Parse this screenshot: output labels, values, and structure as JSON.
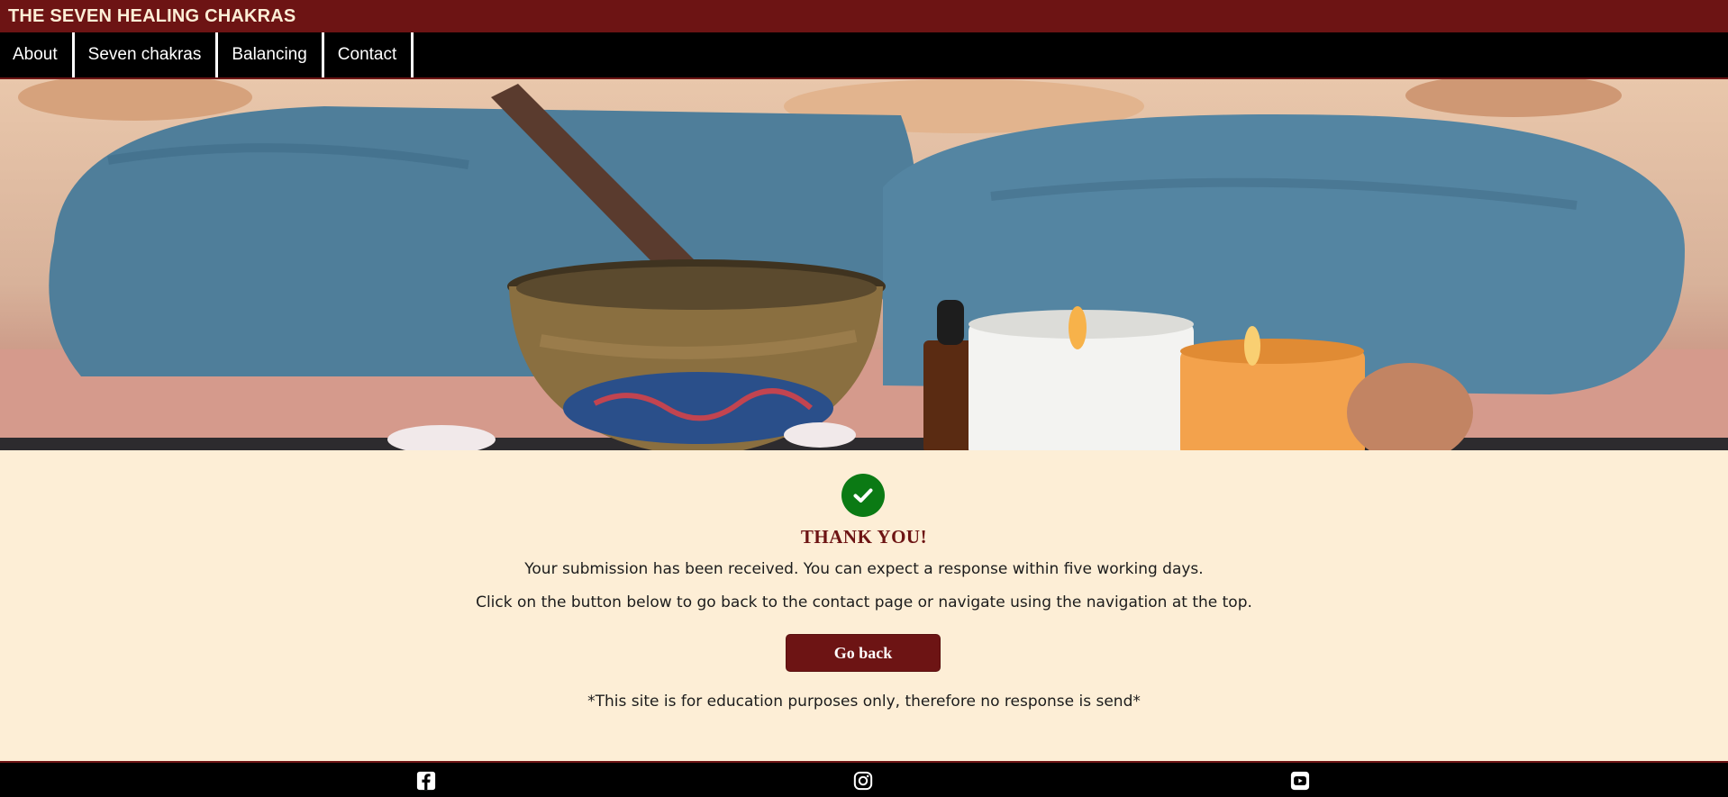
{
  "header": {
    "site_title": "THE SEVEN HEALING CHAKRAS"
  },
  "nav": {
    "items": [
      {
        "label": "About"
      },
      {
        "label": "Seven chakras"
      },
      {
        "label": "Balancing"
      },
      {
        "label": "Contact"
      }
    ]
  },
  "hero": {
    "image_alt_icon": "meditation-scene"
  },
  "confirmation": {
    "icon": "check-circle-icon",
    "title": "THANK YOU!",
    "message_received": "Your submission has been received. You can expect a response within five working days.",
    "message_navigate": "Click on the button below to go back to the contact page or navigate using the navigation at the top.",
    "back_button_label": "Go back",
    "disclaimer": "*This site is for education purposes only, therefore no response is send*"
  },
  "footer": {
    "social": [
      {
        "icon": "facebook-icon"
      },
      {
        "icon": "instagram-icon"
      },
      {
        "icon": "youtube-icon"
      }
    ]
  },
  "colors": {
    "brand": "#6d1414",
    "background": "#fdeed6",
    "success": "#0b7a14",
    "nav_bg": "#000000"
  }
}
